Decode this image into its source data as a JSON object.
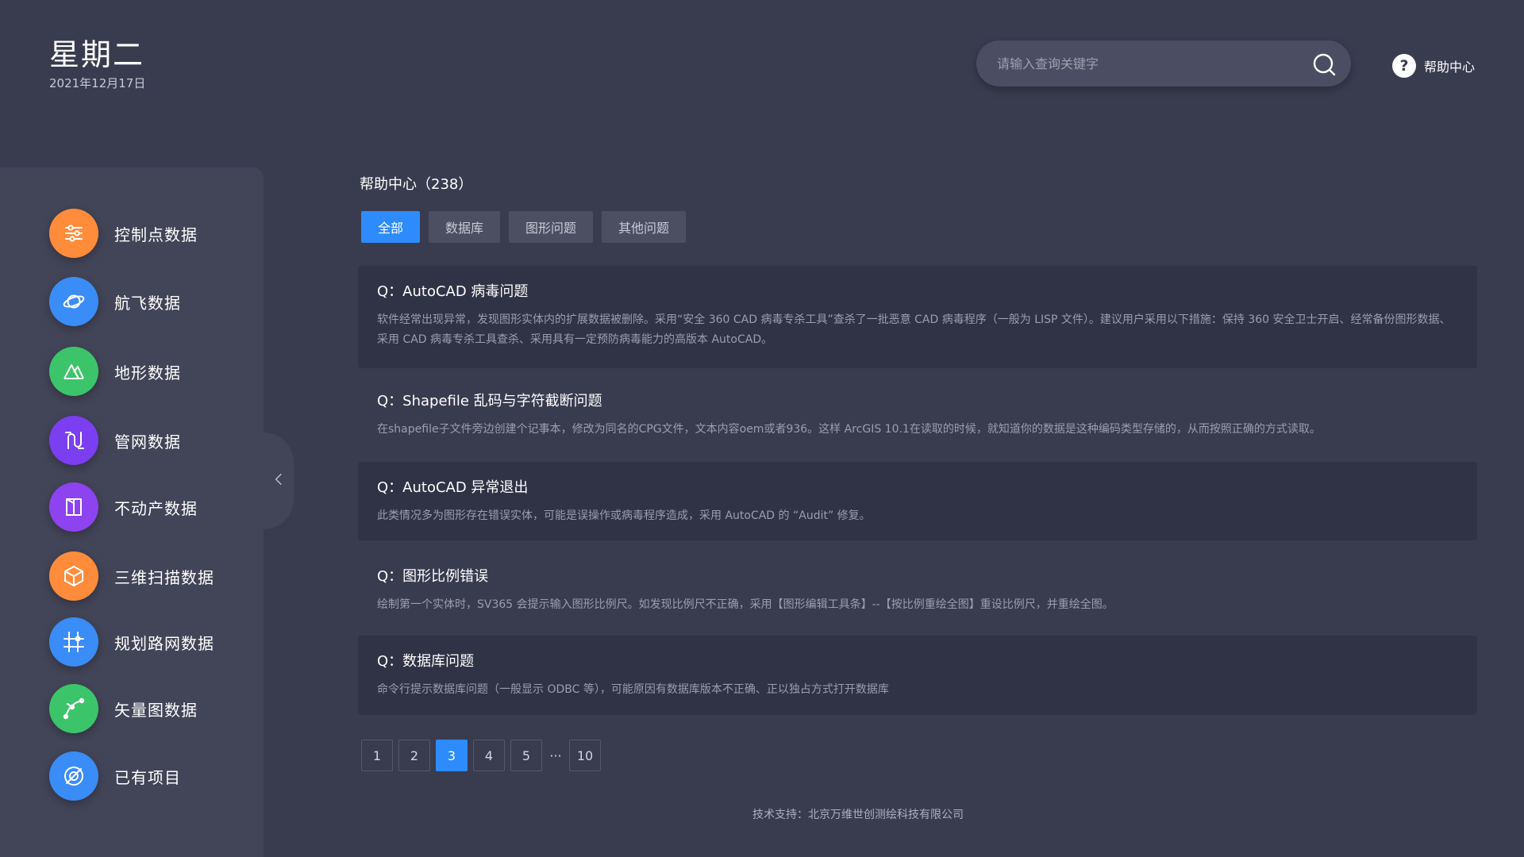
{
  "header": {
    "weekday": "星期二",
    "date": "2021年12月17日",
    "search_placeholder": "请输入查询关键字",
    "help_label": "帮助中心"
  },
  "sidebar": {
    "items": [
      {
        "label": "控制点数据",
        "icon": "sliders-icon",
        "color": "#ff8c3b"
      },
      {
        "label": "航飞数据",
        "icon": "planet-icon",
        "color": "#3a8cf6"
      },
      {
        "label": "地形数据",
        "icon": "mountain-icon",
        "color": "#3cc46a"
      },
      {
        "label": "管网数据",
        "icon": "pipe-icon",
        "color": "#7b3ef0"
      },
      {
        "label": "不动产数据",
        "icon": "building-icon",
        "color": "#8d43ef"
      },
      {
        "label": "三维扫描数据",
        "icon": "cube-icon",
        "color": "#ff8c3b"
      },
      {
        "label": "规划路网数据",
        "icon": "road-network-icon",
        "color": "#3a8cf6"
      },
      {
        "label": "矢量图数据",
        "icon": "vector-curve-icon",
        "color": "#3cc46a"
      },
      {
        "label": "已有项目",
        "icon": "project-icon",
        "color": "#3a8cf6"
      }
    ]
  },
  "main": {
    "title": "帮助中心（238）",
    "tabs": [
      {
        "label": "全部",
        "active": true
      },
      {
        "label": "数据库",
        "active": false
      },
      {
        "label": "图形问题",
        "active": false
      },
      {
        "label": "其他问题",
        "active": false
      }
    ],
    "faqs": [
      {
        "q": "Q：AutoCAD 病毒问题",
        "a": "软件经常出现异常，发现图形实体内的扩展数据被删除。采用“安全 360 CAD 病毒专杀工具”查杀了一批恶意 CAD 病毒程序（一般为 LISP 文件）。建议用户采用以下措施：保持 360 安全卫士开启、经常备份图形数据、采用 CAD 病毒专杀工具查杀、采用具有一定预防病毒能力的高版本 AutoCAD。"
      },
      {
        "q": "Q：Shapefile 乱码与字符截断问题",
        "a": "在shapefile子文件旁边创建个记事本，修改为同名的CPG文件，文本内容oem或者936。这样 ArcGIS 10.1在读取的时候，就知道你的数据是这种编码类型存储的，从而按照正确的方式读取。"
      },
      {
        "q": "Q：AutoCAD 异常退出",
        "a": "此类情况多为图形存在错误实体，可能是误操作或病毒程序造成，采用 AutoCAD 的 “Audit” 修复。"
      },
      {
        "q": "Q：图形比例错误",
        "a": "绘制第一个实体时，SV365 会提示输入图形比例尺。如发现比例尺不正确，采用【图形编辑工具条】--【按比例重绘全图】重设比例尺，并重绘全图。"
      },
      {
        "q": "Q：数据库问题",
        "a": "命令行提示数据库问题（一般显示 ODBC 等），可能原因有数据库版本不正确、正以独占方式打开数据库"
      }
    ],
    "pagination": {
      "pages": [
        "1",
        "2",
        "3",
        "4",
        "5"
      ],
      "ellipsis": "···",
      "last": "10",
      "current": "3"
    }
  },
  "footer": {
    "text": "技术支持：北京万维世创测绘科技有限公司"
  },
  "colors": {
    "background": "#393b4f",
    "sidebar": "#424457",
    "accent": "#2e8bfb",
    "card": "#303245"
  }
}
